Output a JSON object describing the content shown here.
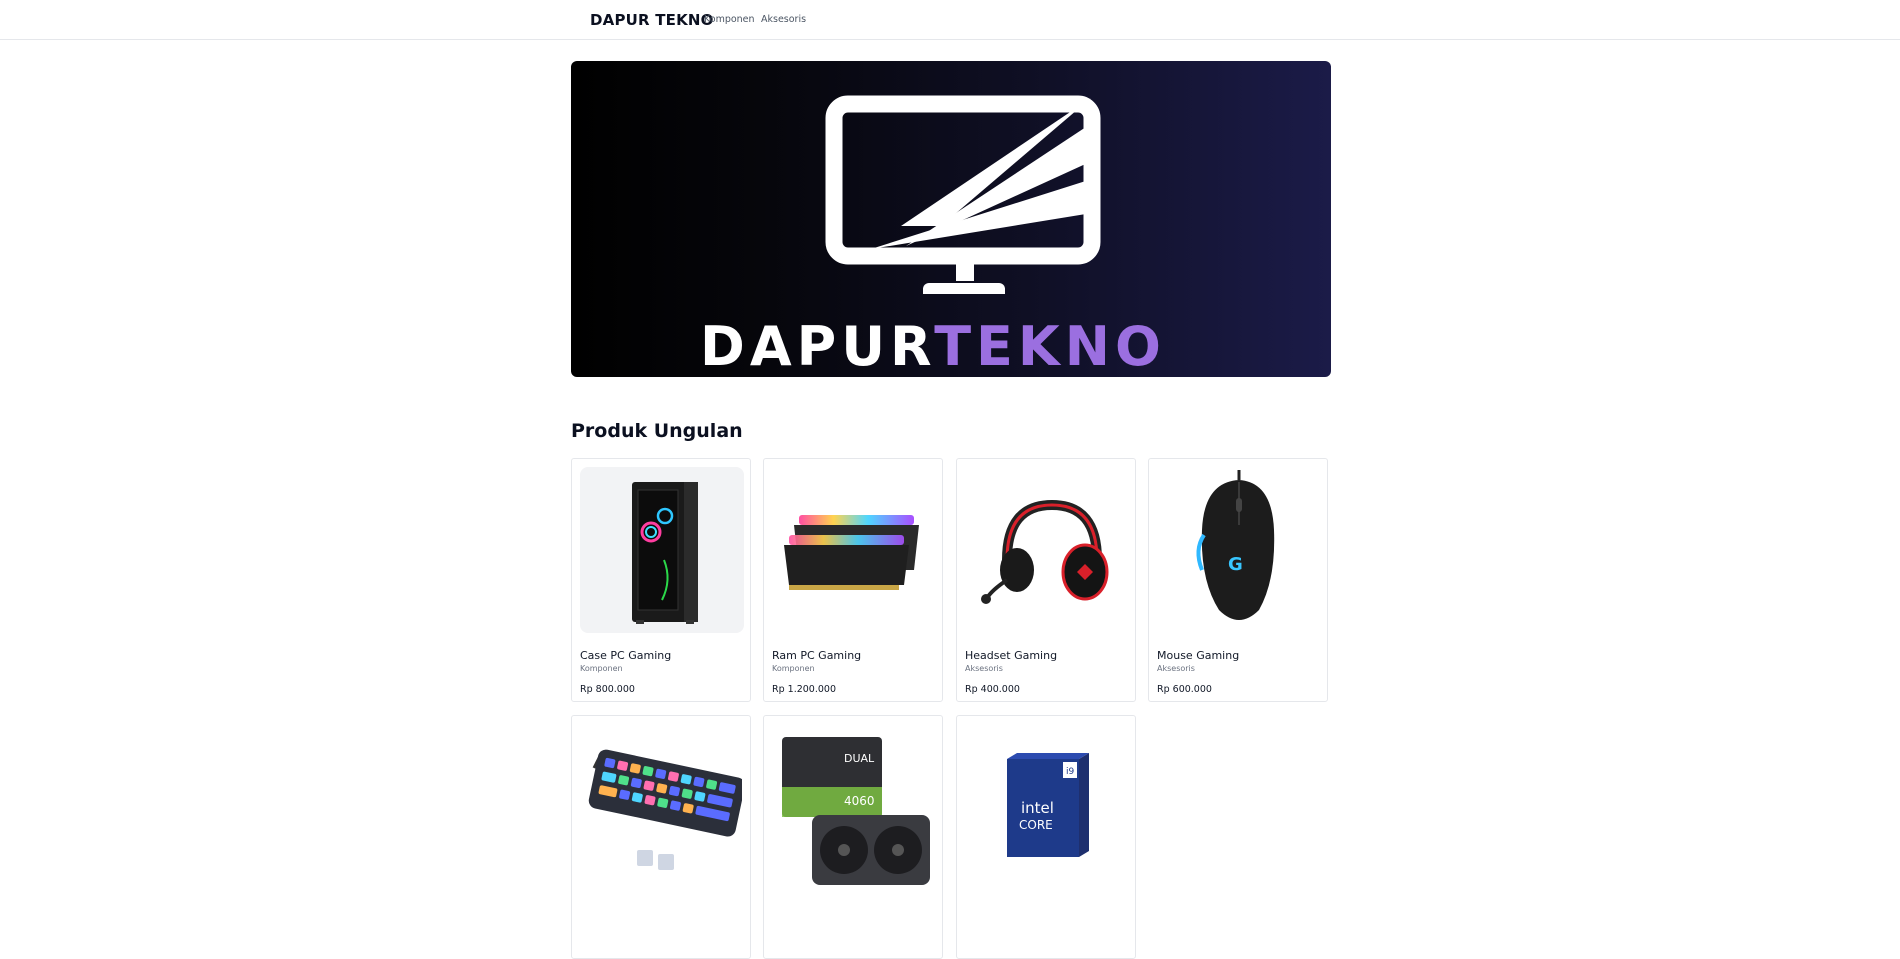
{
  "nav": {
    "brand": "DAPUR TEKNO",
    "links": [
      "Komponen",
      "Aksesoris"
    ]
  },
  "hero": {
    "word_left": "DAPUR",
    "word_right": "TEKNO",
    "colors": {
      "left_word": "#ffffff",
      "right_word": "#9b6fe0",
      "monitor": "#ffffff"
    }
  },
  "section": {
    "title": "Produk Ungulan"
  },
  "products": [
    {
      "name": "Case PC Gaming",
      "category": "Komponen",
      "price": "Rp 800.000",
      "icon": "pc-case-image"
    },
    {
      "name": "Ram PC Gaming",
      "category": "Komponen",
      "price": "Rp 1.200.000",
      "icon": "ram-image"
    },
    {
      "name": "Headset Gaming",
      "category": "Aksesoris",
      "price": "Rp 400.000",
      "icon": "headset-image"
    },
    {
      "name": "Mouse Gaming",
      "category": "Aksesoris",
      "price": "Rp 600.000",
      "icon": "mouse-image"
    },
    {
      "name": "",
      "category": "",
      "price": "",
      "icon": "keyboard-image"
    },
    {
      "name": "",
      "category": "",
      "price": "",
      "icon": "gpu-image",
      "image_text": [
        "DUAL",
        "4060"
      ]
    },
    {
      "name": "",
      "category": "",
      "price": "",
      "icon": "cpu-box-image",
      "image_text": [
        "intel",
        "CORE",
        "i9"
      ]
    }
  ]
}
